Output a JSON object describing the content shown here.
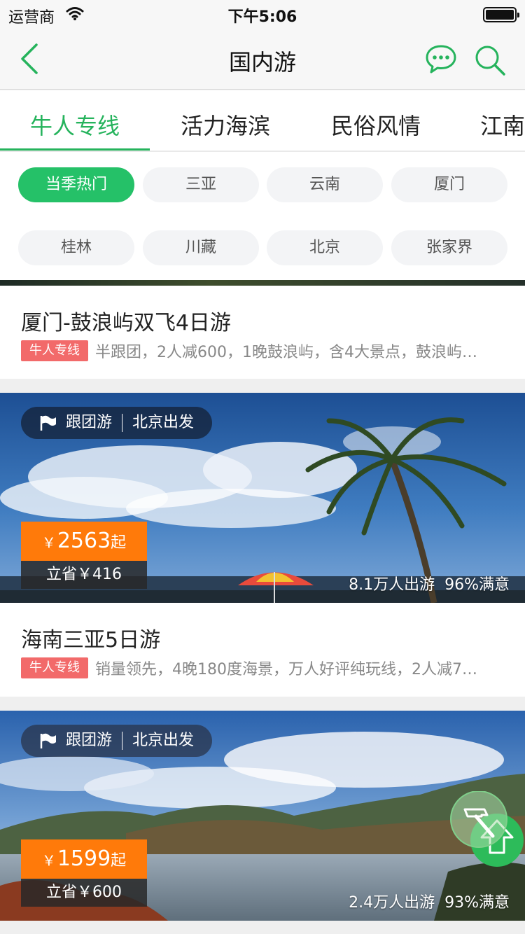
{
  "status_bar": {
    "carrier": "运营商",
    "time": "下午5:06"
  },
  "nav": {
    "title": "国内游"
  },
  "tabs": [
    {
      "label": "牛人专线"
    },
    {
      "label": "活力海滨"
    },
    {
      "label": "民俗风情"
    },
    {
      "label": "江南"
    }
  ],
  "chips": [
    {
      "label": "当季热门"
    },
    {
      "label": "三亚"
    },
    {
      "label": "云南"
    },
    {
      "label": "厦门"
    },
    {
      "label": "桂林"
    },
    {
      "label": "川藏"
    },
    {
      "label": "北京"
    },
    {
      "label": "张家界"
    }
  ],
  "cards": [
    {
      "title": "厦门-鼓浪屿双飞4日游",
      "tag": "牛人专线",
      "desc": "半跟团，2人减600，1晚鼓浪屿，含4大景点，鼓浪屿…"
    },
    {
      "type": "跟团游",
      "departure": "北京出发",
      "currency": "￥",
      "price": "2563",
      "price_suffix": "起",
      "save": "立省￥416",
      "travelers": "8.1万人出游",
      "satisfaction": "96%满意",
      "title": "海南三亚5日游",
      "tag": "牛人专线",
      "desc": "销量领先，4晚180度海景，万人好评纯玩线，2人减7…"
    },
    {
      "type": "跟团游",
      "departure": "北京出发",
      "currency": "￥",
      "price": "1599",
      "price_suffix": "起",
      "save": "立省￥600",
      "travelers": "2.4万人出游",
      "satisfaction": "93%满意"
    }
  ],
  "colors": {
    "accent": "#25b35c",
    "price": "#ff7a0a",
    "tag": "#f26a6a"
  },
  "icons": [
    "back-arrow-icon",
    "chat-bubble-icon",
    "search-icon",
    "wifi-icon",
    "battery-icon",
    "flag-icon",
    "hammer-icon",
    "scroll-to-top-icon"
  ]
}
